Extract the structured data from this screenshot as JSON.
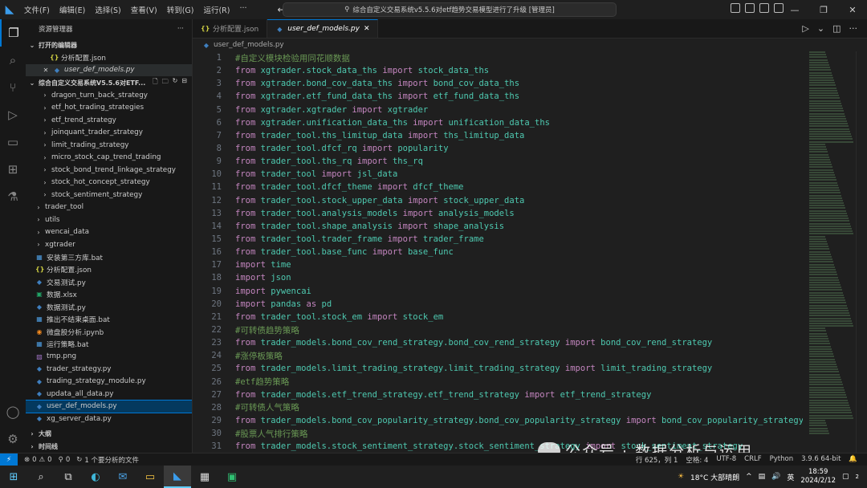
{
  "titlebar": {
    "menu": [
      "文件(F)",
      "编辑(E)",
      "选择(S)",
      "查看(V)",
      "转到(G)",
      "运行(R)",
      "···"
    ],
    "search_text": "综合自定义交易系统v5.5.6对etf趋势交易模型进行了升级 [管理员]"
  },
  "sidebar": {
    "title": "资源管理器",
    "open_editors_label": "打开的编辑器",
    "open_editors": [
      {
        "name": "分析配置.json",
        "icon": "json"
      },
      {
        "name": "user_def_models.py",
        "icon": "py"
      }
    ],
    "folder_label": "综合自定义交易系统V5.5.6对ETF...",
    "tree": [
      {
        "name": "dragon_turn_back_strategy",
        "type": "folder",
        "indent": 2
      },
      {
        "name": "etf_hot_trading_strategies",
        "type": "folder",
        "indent": 2
      },
      {
        "name": "etf_trend_strategy",
        "type": "folder",
        "indent": 2
      },
      {
        "name": "joinquant_trader_strategy",
        "type": "folder",
        "indent": 2
      },
      {
        "name": "limit_trading_strategy",
        "type": "folder",
        "indent": 2
      },
      {
        "name": "micro_stock_cap_trend_trading",
        "type": "folder",
        "indent": 2
      },
      {
        "name": "stock_bond_trend_linkage_strategy",
        "type": "folder",
        "indent": 2
      },
      {
        "name": "stock_hot_concept_strategy",
        "type": "folder",
        "indent": 2
      },
      {
        "name": "stock_sentiment_strategy",
        "type": "folder",
        "indent": 2
      },
      {
        "name": "trader_tool",
        "type": "folder",
        "indent": 1
      },
      {
        "name": "utils",
        "type": "folder",
        "indent": 1
      },
      {
        "name": "wencai_data",
        "type": "folder",
        "indent": 1
      },
      {
        "name": "xgtrader",
        "type": "folder",
        "indent": 1
      },
      {
        "name": "安装第三方库.bat",
        "type": "bat",
        "indent": 1
      },
      {
        "name": "分析配置.json",
        "type": "json",
        "indent": 1
      },
      {
        "name": "交易测试.py",
        "type": "py",
        "indent": 1
      },
      {
        "name": "数据.xlsx",
        "type": "xls",
        "indent": 1
      },
      {
        "name": "数据测试.py",
        "type": "py",
        "indent": 1
      },
      {
        "name": "推出不结束桌面.bat",
        "type": "bat",
        "indent": 1
      },
      {
        "name": "微盘股分析.ipynb",
        "type": "nb",
        "indent": 1
      },
      {
        "name": "运行策略.bat",
        "type": "bat",
        "indent": 1
      },
      {
        "name": "tmp.png",
        "type": "png",
        "indent": 1
      },
      {
        "name": "trader_strategy.py",
        "type": "py",
        "indent": 1
      },
      {
        "name": "trading_strategy_module.py",
        "type": "py",
        "indent": 1
      },
      {
        "name": "updata_all_data.py",
        "type": "py",
        "indent": 1
      },
      {
        "name": "user_def_models.py",
        "type": "py",
        "indent": 1,
        "selected": true
      },
      {
        "name": "xg_server_data.py",
        "type": "py",
        "indent": 1
      }
    ],
    "outline_label": "大纲",
    "timeline_label": "时间线"
  },
  "editor": {
    "tabs": [
      {
        "label": "分析配置.json",
        "icon": "json",
        "active": false
      },
      {
        "label": "user_def_models.py",
        "icon": "py",
        "active": true
      }
    ],
    "breadcrumb": "user_def_models.py",
    "lines": [
      [
        [
          "cm",
          "#自定义模块检验用同花顺数据"
        ]
      ],
      [
        [
          "kw",
          "from "
        ],
        [
          "mod",
          "xgtrader.stock_data_ths "
        ],
        [
          "kw",
          "import "
        ],
        [
          "mod",
          "stock_data_ths"
        ]
      ],
      [
        [
          "kw",
          "from "
        ],
        [
          "mod",
          "xgtrader.bond_cov_data_ths "
        ],
        [
          "kw",
          "import "
        ],
        [
          "mod",
          "bond_cov_data_ths"
        ]
      ],
      [
        [
          "kw",
          "from "
        ],
        [
          "mod",
          "xgtrader.etf_fund_data_ths "
        ],
        [
          "kw",
          "import "
        ],
        [
          "mod",
          "etf_fund_data_ths"
        ]
      ],
      [
        [
          "kw",
          "from "
        ],
        [
          "mod",
          "xgtrader.xgtrader "
        ],
        [
          "kw",
          "import "
        ],
        [
          "mod",
          "xgtrader"
        ]
      ],
      [
        [
          "kw",
          "from "
        ],
        [
          "mod",
          "xgtrader.unification_data_ths "
        ],
        [
          "kw",
          "import "
        ],
        [
          "mod",
          "unification_data_ths"
        ]
      ],
      [
        [
          "kw",
          "from "
        ],
        [
          "mod",
          "trader_tool.ths_limitup_data "
        ],
        [
          "kw",
          "import "
        ],
        [
          "mod",
          "ths_limitup_data"
        ]
      ],
      [
        [
          "kw",
          "from "
        ],
        [
          "mod",
          "trader_tool.dfcf_rq "
        ],
        [
          "kw",
          "import "
        ],
        [
          "mod",
          "popularity"
        ]
      ],
      [
        [
          "kw",
          "from "
        ],
        [
          "mod",
          "trader_tool.ths_rq "
        ],
        [
          "kw",
          "import "
        ],
        [
          "mod",
          "ths_rq"
        ]
      ],
      [
        [
          "kw",
          "from "
        ],
        [
          "mod",
          "trader_tool "
        ],
        [
          "kw",
          "import "
        ],
        [
          "mod",
          "jsl_data"
        ]
      ],
      [
        [
          "kw",
          "from "
        ],
        [
          "mod",
          "trader_tool.dfcf_theme "
        ],
        [
          "kw",
          "import "
        ],
        [
          "mod",
          "dfcf_theme"
        ]
      ],
      [
        [
          "kw",
          "from "
        ],
        [
          "mod",
          "trader_tool.stock_upper_data "
        ],
        [
          "kw",
          "import "
        ],
        [
          "mod",
          "stock_upper_data"
        ]
      ],
      [
        [
          "kw",
          "from "
        ],
        [
          "mod",
          "trader_tool.analysis_models "
        ],
        [
          "kw",
          "import "
        ],
        [
          "mod",
          "analysis_models"
        ]
      ],
      [
        [
          "kw",
          "from "
        ],
        [
          "mod",
          "trader_tool.shape_analysis "
        ],
        [
          "kw",
          "import "
        ],
        [
          "mod",
          "shape_analysis"
        ]
      ],
      [
        [
          "kw",
          "from "
        ],
        [
          "mod",
          "trader_tool.trader_frame "
        ],
        [
          "kw",
          "import "
        ],
        [
          "mod",
          "trader_frame"
        ]
      ],
      [
        [
          "kw",
          "from "
        ],
        [
          "mod",
          "trader_tool.base_func "
        ],
        [
          "kw",
          "import "
        ],
        [
          "mod",
          "base_func"
        ]
      ],
      [
        [
          "kw",
          "import "
        ],
        [
          "mod",
          "time"
        ]
      ],
      [
        [
          "kw",
          "import "
        ],
        [
          "mod",
          "json"
        ]
      ],
      [
        [
          "kw",
          "import "
        ],
        [
          "mod",
          "pywencai"
        ]
      ],
      [
        [
          "kw",
          "import "
        ],
        [
          "mod",
          "pandas "
        ],
        [
          "kw",
          "as "
        ],
        [
          "mod",
          "pd"
        ]
      ],
      [
        [
          "kw",
          "from "
        ],
        [
          "mod",
          "trader_tool.stock_em "
        ],
        [
          "kw",
          "import "
        ],
        [
          "mod",
          "stock_em"
        ]
      ],
      [
        [
          "cm",
          "#可转债趋势策略"
        ]
      ],
      [
        [
          "kw",
          "from "
        ],
        [
          "mod",
          "trader_models.bond_cov_rend_strategy.bond_cov_rend_strategy "
        ],
        [
          "kw",
          "import "
        ],
        [
          "mod",
          "bond_cov_rend_strategy"
        ]
      ],
      [
        [
          "cm",
          "#涨停板策略"
        ]
      ],
      [
        [
          "kw",
          "from "
        ],
        [
          "mod",
          "trader_models.limit_trading_strategy.limit_trading_strategy "
        ],
        [
          "kw",
          "import "
        ],
        [
          "mod",
          "limit_trading_strategy"
        ]
      ],
      [
        [
          "cm",
          "#etf趋势策略"
        ]
      ],
      [
        [
          "kw",
          "from "
        ],
        [
          "mod",
          "trader_models.etf_trend_strategy.etf_trend_strategy "
        ],
        [
          "kw",
          "import "
        ],
        [
          "mod",
          "etf_trend_strategy"
        ]
      ],
      [
        [
          "cm",
          "#可转债人气策略"
        ]
      ],
      [
        [
          "kw",
          "from "
        ],
        [
          "mod",
          "trader_models.bond_cov_popularity_strategy.bond_cov_popularity_strategy "
        ],
        [
          "kw",
          "import "
        ],
        [
          "mod",
          "bond_cov_popularity_strategy"
        ]
      ],
      [
        [
          "cm",
          "#股票人气排行策略"
        ]
      ],
      [
        [
          "kw",
          "from "
        ],
        [
          "mod",
          "trader_models.stock_sentiment_strategy.stock_sentiment_strategy "
        ],
        [
          "kw",
          "import "
        ],
        [
          "mod",
          "stock_sentiment_strategy"
        ]
      ]
    ]
  },
  "statusbar": {
    "errors": "0",
    "warnings": "0",
    "ports": "0",
    "analysis": "1 个要分析的文件",
    "cursor": "行 625，列 1",
    "spaces": "空格: 4",
    "encoding": "UTF-8",
    "eol": "CRLF",
    "language": "Python",
    "version": "3.9.6 64-bit"
  },
  "taskbar": {
    "weather": "18°C 大部晴朗",
    "ime": "英",
    "time": "18:59",
    "date": "2024/2/12",
    "notification_count": "2"
  },
  "watermark": "公众号 · 数据分析与运用",
  "colors": {
    "keyword": "#c586c0",
    "module": "#4ec9b0",
    "comment": "#6a9955",
    "accent": "#0078d4"
  }
}
